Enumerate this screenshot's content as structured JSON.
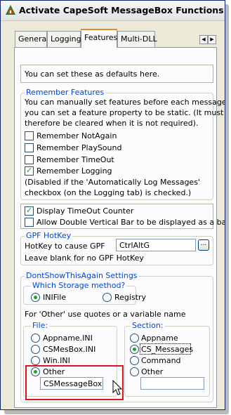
{
  "window": {
    "title": "Activate CapeSoft MessageBox Functions"
  },
  "tabs": [
    {
      "label": "General",
      "active": false
    },
    {
      "label": "Logging",
      "active": false
    },
    {
      "label": "Features",
      "active": true
    },
    {
      "label": "Multi-DLL",
      "active": false
    }
  ],
  "tab_scroll": {
    "left_icon": "chevron-left-icon",
    "right_icon": "chevron-right-icon"
  },
  "intro": {
    "text": "You can set these as defaults here."
  },
  "remember_features": {
    "legend": "Remember Features",
    "description": [
      "You can manually set features before each message or",
      "you can set a feature property to be static. (It must",
      "therefore be cleared when it is not required)."
    ],
    "checkboxes": [
      {
        "label": "Remember NotAgain",
        "checked": false
      },
      {
        "label": "Remember PlaySound",
        "checked": false
      },
      {
        "label": "Remember TimeOut",
        "checked": false
      },
      {
        "label": "Remember Logging",
        "checked": true
      }
    ],
    "note": [
      "(Disabled if the 'Automatically Log Messages'",
      "checkbox (on the Logging tab) is checked.)"
    ]
  },
  "display_options": [
    {
      "label": "Display TimeOut Counter",
      "checked": true
    },
    {
      "label": "Allow Double Vertical Bar to be displayed as a bar",
      "checked": false
    }
  ],
  "gpf_hotkey": {
    "legend": "GPF HotKey",
    "field_label": "HotKey to cause GPF",
    "value": "CtrlAltG",
    "button_label": "...",
    "hint": "Leave blank for no GPF HotKey"
  },
  "dontshow": {
    "legend": "DontShowThisAgain Settings",
    "storage": {
      "legend": "Which Storage method?",
      "options": [
        {
          "label": "INIFile",
          "selected": true
        },
        {
          "label": "Registry",
          "selected": false
        }
      ]
    },
    "other_hint": "For 'Other' use quotes or a variable name",
    "file": {
      "legend": "File:",
      "options": [
        {
          "label": "Appname.INI",
          "selected": false
        },
        {
          "label": "CSMesBox.INI",
          "selected": false
        },
        {
          "label": "Win.INI",
          "selected": false
        },
        {
          "label": "Other",
          "selected": true
        }
      ],
      "other_value": "CSMessageBox"
    },
    "section": {
      "legend": "Section:",
      "options": [
        {
          "label": "Appname",
          "selected": false
        },
        {
          "label": "CS_Messages",
          "selected": true
        },
        {
          "label": "Command",
          "selected": false
        },
        {
          "label": "Other",
          "selected": false
        }
      ],
      "other_value": ""
    }
  },
  "colors": {
    "highlight": "#e0141b",
    "legend_text": "#0046d5",
    "check_mark": "#21a121",
    "active_tab_accent": "#e68b2c"
  }
}
